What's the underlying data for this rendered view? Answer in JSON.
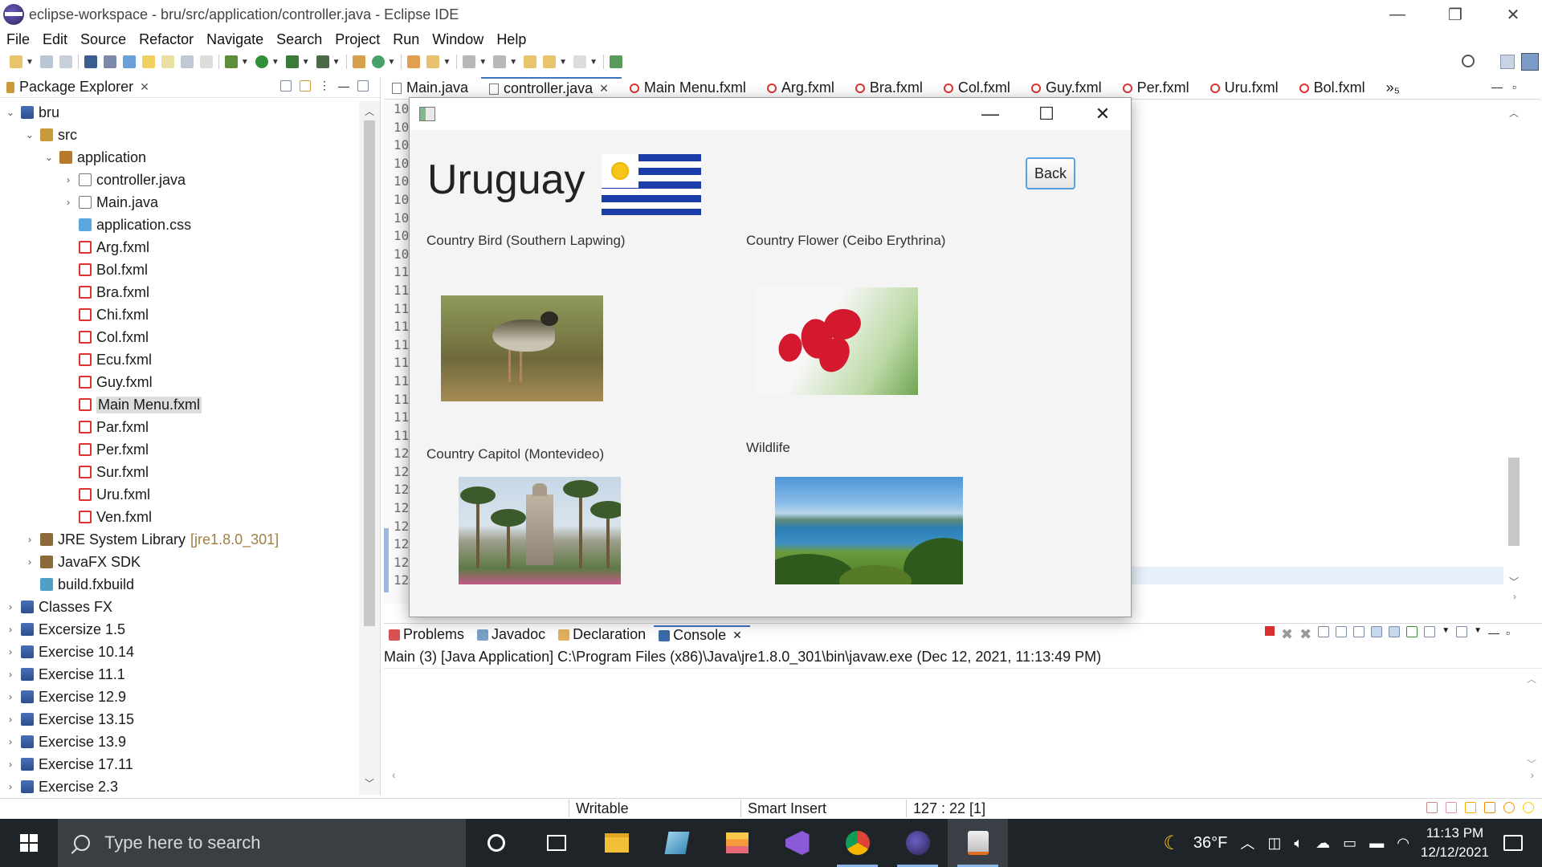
{
  "window": {
    "title": "eclipse-workspace - bru/src/application/controller.java - Eclipse IDE",
    "controls": {
      "minimize": "—",
      "restore": "❐",
      "close": "✕"
    }
  },
  "menu": [
    "File",
    "Edit",
    "Source",
    "Refactor",
    "Navigate",
    "Search",
    "Project",
    "Run",
    "Window",
    "Help"
  ],
  "package_explorer": {
    "title": "Package Explorer",
    "close": "✕",
    "tree": [
      {
        "label": "bru",
        "level": 0,
        "icon": "project-icon",
        "twisty": "⌄"
      },
      {
        "label": "src",
        "level": 1,
        "icon": "source-folder-icon",
        "twisty": "⌄"
      },
      {
        "label": "application",
        "level": 2,
        "icon": "package-icon",
        "twisty": "⌄"
      },
      {
        "label": "controller.java",
        "level": 3,
        "icon": "java-file-icon",
        "twisty": "›"
      },
      {
        "label": "Main.java",
        "level": 3,
        "icon": "java-file-icon",
        "twisty": "›"
      },
      {
        "label": "application.css",
        "level": 3,
        "icon": "css-file-icon",
        "twisty": ""
      },
      {
        "label": "Arg.fxml",
        "level": 3,
        "icon": "fxml-file-icon",
        "twisty": ""
      },
      {
        "label": "Bol.fxml",
        "level": 3,
        "icon": "fxml-file-icon",
        "twisty": ""
      },
      {
        "label": "Bra.fxml",
        "level": 3,
        "icon": "fxml-file-icon",
        "twisty": ""
      },
      {
        "label": "Chi.fxml",
        "level": 3,
        "icon": "fxml-file-icon",
        "twisty": ""
      },
      {
        "label": "Col.fxml",
        "level": 3,
        "icon": "fxml-file-icon",
        "twisty": ""
      },
      {
        "label": "Ecu.fxml",
        "level": 3,
        "icon": "fxml-file-icon",
        "twisty": ""
      },
      {
        "label": "Guy.fxml",
        "level": 3,
        "icon": "fxml-file-icon",
        "twisty": ""
      },
      {
        "label": "Main Menu.fxml",
        "level": 3,
        "icon": "fxml-file-icon",
        "twisty": "",
        "selected": true
      },
      {
        "label": "Par.fxml",
        "level": 3,
        "icon": "fxml-file-icon",
        "twisty": ""
      },
      {
        "label": "Per.fxml",
        "level": 3,
        "icon": "fxml-file-icon",
        "twisty": ""
      },
      {
        "label": "Sur.fxml",
        "level": 3,
        "icon": "fxml-file-icon",
        "twisty": ""
      },
      {
        "label": "Uru.fxml",
        "level": 3,
        "icon": "fxml-file-icon",
        "twisty": ""
      },
      {
        "label": "Ven.fxml",
        "level": 3,
        "icon": "fxml-file-icon",
        "twisty": ""
      },
      {
        "label": "JRE System Library",
        "suffix": "[jre1.8.0_301]",
        "level": 1,
        "icon": "library-icon",
        "twisty": "›"
      },
      {
        "label": "JavaFX SDK",
        "level": 1,
        "icon": "library-icon",
        "twisty": "›"
      },
      {
        "label": "build.fxbuild",
        "level": 1,
        "icon": "build-file-icon",
        "twisty": ""
      },
      {
        "label": "Classes FX",
        "level": 0,
        "icon": "project-icon",
        "twisty": "›"
      },
      {
        "label": "Excersize 1.5",
        "level": 0,
        "icon": "project-icon",
        "twisty": "›"
      },
      {
        "label": "Exercise 10.14",
        "level": 0,
        "icon": "project-icon",
        "twisty": "›"
      },
      {
        "label": "Exercise 11.1",
        "level": 0,
        "icon": "project-icon",
        "twisty": "›"
      },
      {
        "label": "Exercise 12.9",
        "level": 0,
        "icon": "project-icon",
        "twisty": "›"
      },
      {
        "label": "Exercise 13.15",
        "level": 0,
        "icon": "project-icon",
        "twisty": "›"
      },
      {
        "label": "Exercise 13.9",
        "level": 0,
        "icon": "project-icon",
        "twisty": "›"
      },
      {
        "label": "Exercise 17.11",
        "level": 0,
        "icon": "project-icon",
        "twisty": "›"
      },
      {
        "label": "Exercise 2.3",
        "level": 0,
        "icon": "project-icon",
        "twisty": "›"
      }
    ]
  },
  "editor": {
    "tabs": [
      {
        "label": "Main.java",
        "icon": "java-file-icon",
        "active": false
      },
      {
        "label": "controller.java",
        "icon": "java-file-icon",
        "active": true,
        "close": "✕"
      },
      {
        "label": "Main Menu.fxml",
        "icon": "fxml-file-icon",
        "active": false
      },
      {
        "label": "Arg.fxml",
        "icon": "fxml-file-icon",
        "active": false
      },
      {
        "label": "Bra.fxml",
        "icon": "fxml-file-icon",
        "active": false
      },
      {
        "label": "Col.fxml",
        "icon": "fxml-file-icon",
        "active": false
      },
      {
        "label": "Guy.fxml",
        "icon": "fxml-file-icon",
        "active": false
      },
      {
        "label": "Per.fxml",
        "icon": "fxml-file-icon",
        "active": false
      },
      {
        "label": "Uru.fxml",
        "icon": "fxml-file-icon",
        "active": false
      },
      {
        "label": "Bol.fxml",
        "icon": "fxml-file-icon",
        "active": false
      }
    ],
    "more_tabs": "»₅",
    "line_numbers": [
      "10",
      "10",
      "10",
      "10",
      "10",
      "10",
      "10",
      "10",
      "10",
      "11",
      "11",
      "11",
      "11",
      "11",
      "11",
      "11",
      "11",
      "11",
      "11",
      "12",
      "12",
      "12",
      "12",
      "12",
      "12",
      "12",
      "12"
    ]
  },
  "console": {
    "tabs": [
      {
        "label": "Problems",
        "icon": "problems-icon",
        "active": false
      },
      {
        "label": "Javadoc",
        "icon": "javadoc-icon",
        "active": false
      },
      {
        "label": "Declaration",
        "icon": "declaration-icon",
        "active": false
      },
      {
        "label": "Console",
        "icon": "console-icon",
        "active": true,
        "close": "✕"
      }
    ],
    "status": "Main (3) [Java Application] C:\\Program Files (x86)\\Java\\jre1.8.0_301\\bin\\javaw.exe  (Dec 12, 2021, 11:13:49 PM)"
  },
  "statusbar": {
    "writable": "Writable",
    "insert_mode": "Smart Insert",
    "position": "127 : 22 [1]"
  },
  "fx_app": {
    "title_controls": {
      "minimize": "—",
      "maximize": "☐",
      "close": "✕"
    },
    "heading": "Uruguay",
    "back_button": "Back",
    "labels": {
      "bird": "Country Bird (Southern Lapwing)",
      "flower": "Country Flower (Ceibo Erythrina)",
      "capital": "Country Capitol (Montevideo)",
      "wildlife": "Wildlife"
    }
  },
  "taskbar": {
    "search_placeholder": "Type here to search",
    "weather": "36°F",
    "time": "11:13 PM",
    "date": "12/12/2021",
    "apps": [
      "cortana-icon",
      "task-view-icon",
      "file-explorer-icon",
      "notepad-icon",
      "stack-icon",
      "visual-studio-icon",
      "chrome-icon",
      "eclipse-icon",
      "java-icon"
    ]
  }
}
